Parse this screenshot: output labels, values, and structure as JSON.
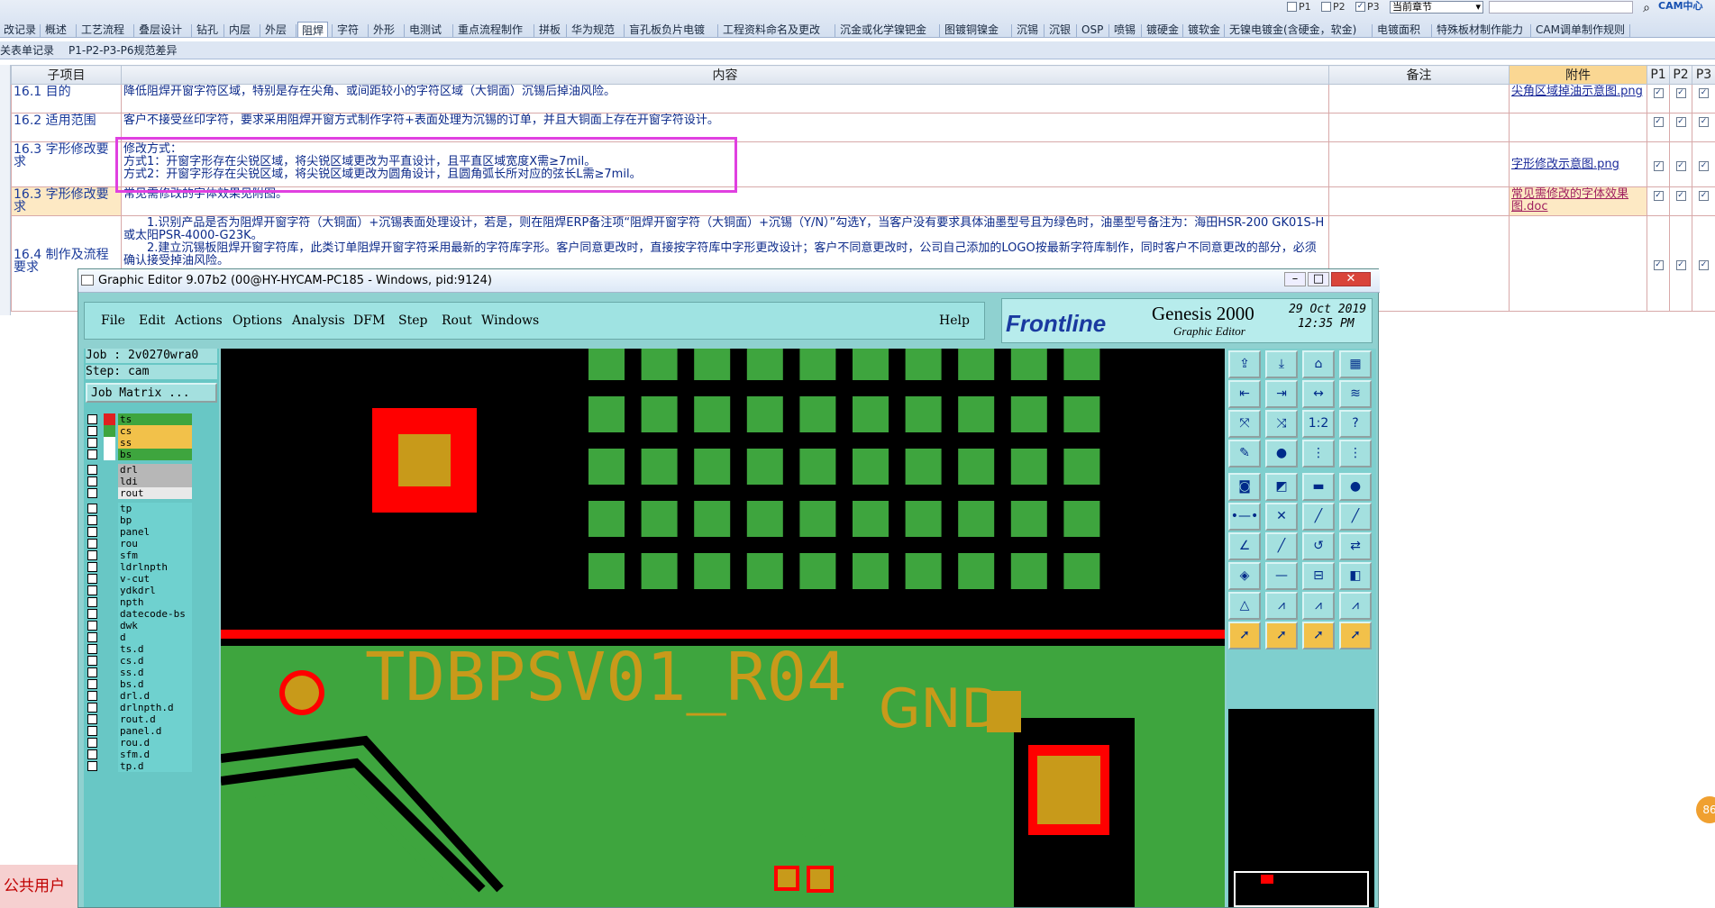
{
  "top_tabs": [
    {
      "label": "改记录"
    },
    {
      "label": "概述"
    },
    {
      "label": "工艺流程"
    },
    {
      "label": "叠层设计"
    },
    {
      "label": "钻孔"
    },
    {
      "label": "内层"
    },
    {
      "label": "外层"
    },
    {
      "label": "阻焊",
      "active": true
    },
    {
      "label": "字符"
    },
    {
      "label": "外形"
    },
    {
      "label": "电测试"
    },
    {
      "label": "重点流程制作"
    },
    {
      "label": "拼板"
    },
    {
      "label": "华为规范"
    },
    {
      "label": "盲孔板负片电镀"
    },
    {
      "label": "工程资料命名及更改"
    },
    {
      "label": "沉金或化学镍钯金"
    },
    {
      "label": "图镀铜镍金"
    },
    {
      "label": "沉锡"
    },
    {
      "label": "沉银"
    },
    {
      "label": "OSP"
    },
    {
      "label": "喷锡"
    },
    {
      "label": "镀硬金"
    },
    {
      "label": "镀软金"
    },
    {
      "label": "无镍电镀金(含硬金，软金)"
    },
    {
      "label": "电镀面积"
    },
    {
      "label": "特殊板材制作能力"
    },
    {
      "label": "CAM调单制作规则"
    }
  ],
  "top_right": {
    "p1": "P1",
    "p2": "P2",
    "p3": "P3",
    "chapter_select": "当前章节",
    "brand": "CAM中心"
  },
  "sub_tabs": [
    {
      "label": "关表单记录"
    },
    {
      "label": "P1-P2-P3-P6规范差异"
    }
  ],
  "grid": {
    "headers": {
      "sub": "子项目",
      "content": "内容",
      "remark": "备注",
      "attach": "附件",
      "p1": "P1",
      "p2": "P2",
      "p3": "P3"
    },
    "rows": [
      {
        "sub": "16.1 目的",
        "content": "降低阻焊开窗字符区域，特别是存在尖角、或间距较小的字符区域（大铜面）沉锡后掉油风险。",
        "attach": "尖角区域掉油示意图.png"
      },
      {
        "sub": "16.2 适用范围",
        "content": "客户不接受丝印字符，要求采用阻焊开窗方式制作字符+表面处理为沉锡的订单，并且大铜面上存在开窗字符设计。",
        "attach": ""
      },
      {
        "sub": "16.3 字形修改要求",
        "line1": "修改方式：",
        "line2": "方式1：开窗字形存在尖锐区域，将尖锐区域更改为平直设计，且平直区域宽度X需≥7mil。",
        "line3": "方式2：开窗字形存在尖锐区域，将尖锐区域更改为圆角设计，且圆角弧长所对应的弦长L需≥7mil。",
        "attach": "字形修改示意图.png"
      },
      {
        "sub": "16.3 字形修改要求",
        "content": "常见需修改的字体效果见附图。",
        "attach": "常见需修改的字体效果图.doc"
      },
      {
        "sub": "16.4 制作及流程要求",
        "line1": "1.识别产品是否为阻焊开窗字符（大铜面）+沉锡表面处理设计，若是，则在阻焊ERP备注项“阻焊开窗字符（大铜面）+沉锡（Y/N）”勾选Y，当客户没有要求具体油墨型号且为绿色时，油墨型号备注为：海田HSR-200 GK01S-H或太阳PSR-4000-G23K。",
        "line2": "2.建立沉锡板阻焊开窗字符库，此类订单阻焊开窗字符采用最新的字符库字形。客户同意更改时，直接按字符库中字形更改设计；客户不同意更改时，公司自己添加的LOGO按最新字符库制作，同时客户不同意更改的部分，必须确认接受掉油风险。",
        "attach": ""
      }
    ]
  },
  "ge": {
    "title": "Graphic Editor 9.07b2 (00@HY-HYCAM-PC185 - Windows, pid:9124)",
    "menu": {
      "file": "File",
      "edit": "Edit",
      "actions": "Actions",
      "options": "Options",
      "analysis": "Analysis",
      "dfm": "DFM",
      "step": "Step",
      "rout": "Rout",
      "windows": "Windows",
      "help": "Help"
    },
    "brand": {
      "logo": "Frontline",
      "product": "Genesis 2000",
      "sub": "Graphic Editor",
      "date": "29 Oct 2019",
      "time": "12:35 PM"
    },
    "job": "Job : 2v0270wra0",
    "step": "Step: cam",
    "matrix_btn": "Job Matrix ...",
    "layers_top": [
      {
        "name": "ts",
        "color": "#3ea53e",
        "swatch": "#e02020"
      },
      {
        "name": "cs",
        "color": "#f2c14a",
        "swatch": "#3ea53e"
      },
      {
        "name": "ss",
        "color": "#f2c14a",
        "swatch": "#fff"
      },
      {
        "name": "bs",
        "color": "#3ea53e",
        "swatch": "#fff"
      }
    ],
    "layers_mid": [
      {
        "name": "drl",
        "color": "#b7b7b7"
      },
      {
        "name": "ldi",
        "color": "#b7b7b7"
      },
      {
        "name": "rout",
        "color": "#e9e9e9"
      }
    ],
    "layers_bottom": [
      "tp",
      "bp",
      "panel",
      "rou",
      "sfm",
      "ldrlnpth",
      "v-cut",
      "ydkdrl",
      "npth",
      "datecode-bs",
      "dwk",
      "d",
      "ts.d",
      "cs.d",
      "ss.d",
      "bs.d",
      "drl.d",
      "drlnpth.d",
      "rout.d",
      "panel.d",
      "rou.d",
      "sfm.d",
      "tp.d"
    ],
    "canvas_text_1": "TDBPSV01_R04",
    "canvas_text_2": "GND"
  },
  "status": {
    "user": "公共用户",
    "badge": "86"
  }
}
